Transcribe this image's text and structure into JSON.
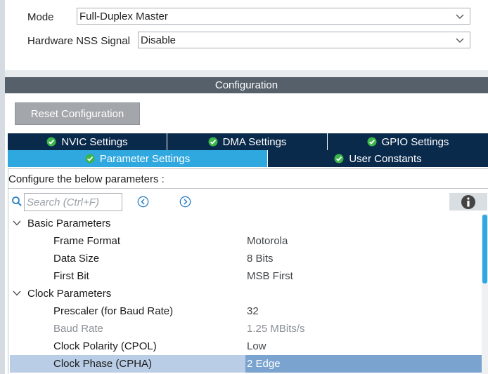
{
  "mode": {
    "mode_label": "Mode",
    "mode_value": "Full-Duplex Master",
    "nss_label": "Hardware NSS Signal",
    "nss_value": "Disable"
  },
  "configuration": {
    "title": "Configuration",
    "reset_label": "Reset Configuration"
  },
  "tabs": [
    {
      "label": "NVIC Settings",
      "active": false
    },
    {
      "label": "DMA Settings",
      "active": false
    },
    {
      "label": "GPIO Settings",
      "active": false
    },
    {
      "label": "Parameter Settings",
      "active": true
    },
    {
      "label": "User Constants",
      "active": false
    }
  ],
  "parameters": {
    "configure_text": "Configure the below parameters :",
    "search_placeholder": "Search (Ctrl+F)",
    "groups": [
      {
        "label": "Basic Parameters",
        "items": [
          {
            "name": "Frame Format",
            "value": "Motorola"
          },
          {
            "name": "Data Size",
            "value": "8 Bits"
          },
          {
            "name": "First Bit",
            "value": "MSB First"
          }
        ]
      },
      {
        "label": "Clock Parameters",
        "items": [
          {
            "name": "Prescaler (for Baud Rate)",
            "value": "32"
          },
          {
            "name": "Baud Rate",
            "value": "1.25 MBits/s",
            "disabled": true
          },
          {
            "name": "Clock Polarity (CPOL)",
            "value": "Low"
          },
          {
            "name": "Clock Phase (CPHA)",
            "value": "2 Edge",
            "selected": true
          }
        ]
      }
    ]
  },
  "icons": {
    "dropdown": "chevron-down-icon",
    "tab_ok": "check-circle-icon",
    "search": "search-icon",
    "prev": "chevron-left-circle-icon",
    "next": "chevron-right-circle-icon",
    "info": "info-icon",
    "expand": "chevron-down-icon"
  },
  "colors": {
    "tab_bg": "#0a2a4c",
    "tab_active": "#2fa7df",
    "header_bg": "#56606a",
    "selected_row": "#b9cde6",
    "selected_value": "#7aa3cf",
    "tick_green": "#3bb54a"
  }
}
